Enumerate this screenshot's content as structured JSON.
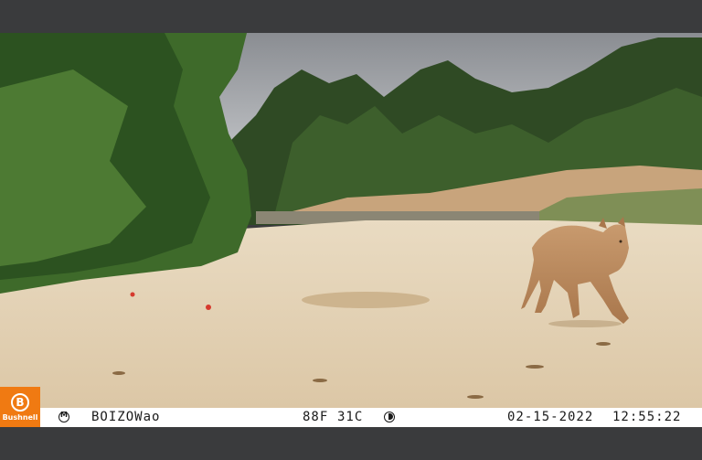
{
  "brand": {
    "letter": "B",
    "name": "Bushnell"
  },
  "overlay": {
    "camera_name": "BOIZOWao",
    "temperature_f": "88F",
    "temperature_c": "31C",
    "date": "02-15-2022",
    "time": "12:55:22"
  },
  "icons": {
    "camera_mode": "moon-mode-icon",
    "moon_phase": "moon-phase-icon"
  },
  "colors": {
    "brand_orange": "#f07a12",
    "frame": "#3a3b3d",
    "strip": "#ffffff"
  }
}
